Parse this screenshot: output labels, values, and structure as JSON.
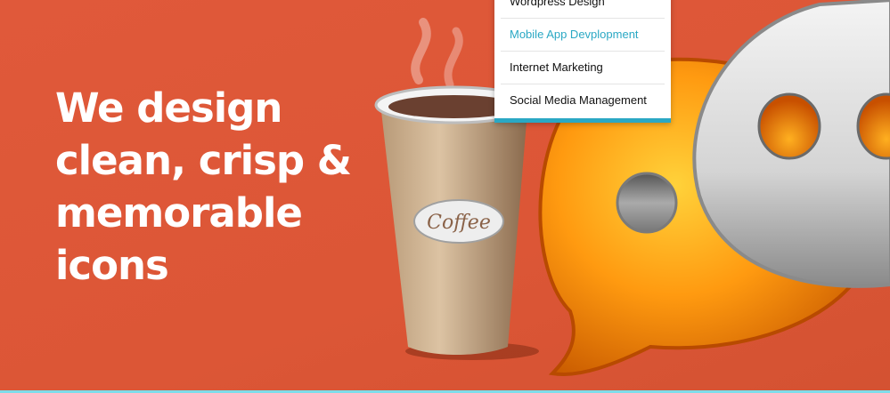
{
  "hero": {
    "headline_lines": [
      "We design",
      "clean, crisp &",
      "memorable",
      "icons"
    ],
    "cup_label": "Coffee"
  },
  "dropdown": {
    "items": [
      {
        "label": "Wordpress Design",
        "active": false
      },
      {
        "label": "Mobile App Devplopment",
        "active": true
      },
      {
        "label": "Internet Marketing",
        "active": false
      },
      {
        "label": "Social Media Management",
        "active": false
      }
    ]
  },
  "colors": {
    "background": "#dc5636",
    "accent": "#2aa8c4",
    "bottom_line": "#7fdcea"
  }
}
